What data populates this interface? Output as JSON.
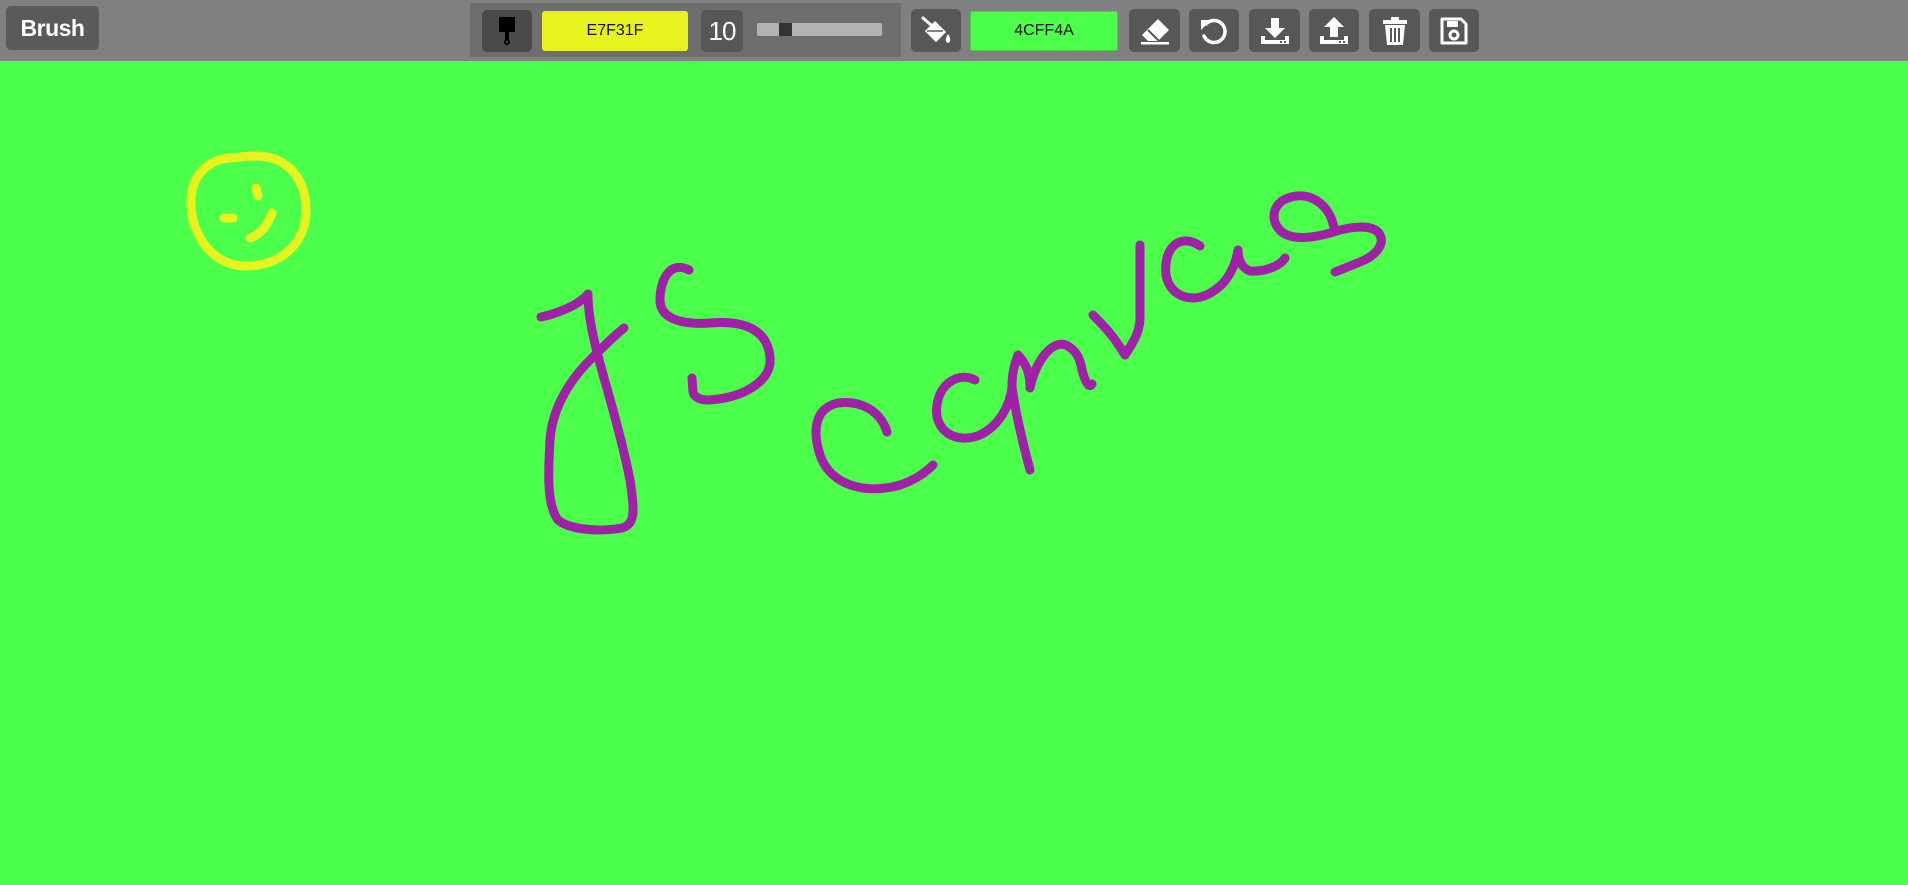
{
  "toolbar": {
    "tool_name": "Brush",
    "brush_color": "E7F31F",
    "brush_color_hex": "#E7F31F",
    "brush_size": "10",
    "brush_size_fraction": 0.2,
    "background_color": "4CFF4A",
    "background_color_hex": "#4CFF4A",
    "icons": {
      "brush": "paint-brush-icon",
      "fill": "fill-bucket-icon",
      "eraser": "eraser-icon",
      "undo": "undo-icon",
      "download": "download-icon",
      "upload": "upload-icon",
      "clear": "trash-icon",
      "save": "save-icon"
    }
  },
  "canvas": {
    "background": "#4CFF4A",
    "strokes": [
      {
        "name": "smiley-drawing",
        "color": "#E7F31F"
      },
      {
        "name": "js-canvas-handwriting",
        "color": "#A020A8"
      }
    ]
  }
}
